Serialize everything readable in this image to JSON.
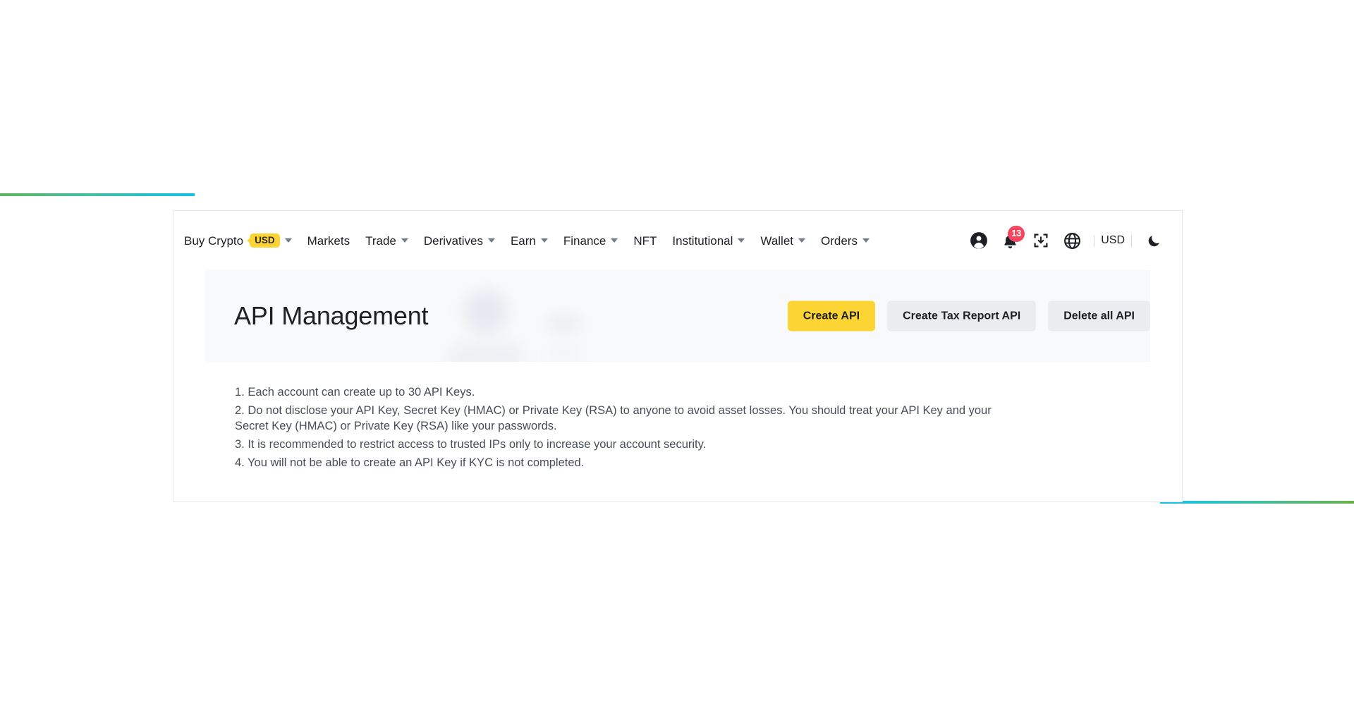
{
  "nav": {
    "items": [
      {
        "label": "Buy Crypto",
        "badge": "USD",
        "caret": true
      },
      {
        "label": "Markets",
        "caret": false
      },
      {
        "label": "Trade",
        "caret": true
      },
      {
        "label": "Derivatives",
        "caret": true
      },
      {
        "label": "Earn",
        "caret": true
      },
      {
        "label": "Finance",
        "caret": true
      },
      {
        "label": "NFT",
        "caret": false
      },
      {
        "label": "Institutional",
        "caret": true
      },
      {
        "label": "Wallet",
        "caret": true
      },
      {
        "label": "Orders",
        "caret": true
      }
    ],
    "right": {
      "profile_icon": "user-circle-icon",
      "notification_icon": "bell-icon",
      "notification_count": "13",
      "download_icon": "download-box-icon",
      "language_icon": "globe-icon",
      "currency": "USD",
      "theme_icon": "moon-icon"
    }
  },
  "header": {
    "title": "API Management",
    "buttons": {
      "create_api": "Create API",
      "create_tax_report_api": "Create Tax Report API",
      "delete_all_api": "Delete all API"
    }
  },
  "notes": [
    "1. Each account can create up to 30 API Keys.",
    "2. Do not disclose your API Key, Secret Key (HMAC) or Private Key (RSA) to anyone to avoid asset losses. You should treat your API Key and your Secret Key (HMAC) or Private Key (RSA) like your passwords.",
    "3. It is recommended to restrict access to trusted IPs only to increase your account security.",
    "4. You will not be able to create an API Key if KYC is not completed."
  ],
  "annotation": {
    "arrow_color": "#fa2b18",
    "points_to": "Create API"
  },
  "colors": {
    "brand_yellow": "#fcd535",
    "badge_red": "#f6465d",
    "text_primary": "#1e2026",
    "text_secondary": "#474d57",
    "button_grey": "#eaecef",
    "header_band": "#f8f9fa",
    "gradient_green": "#6ab04c",
    "gradient_cyan": "#12c2e9"
  }
}
